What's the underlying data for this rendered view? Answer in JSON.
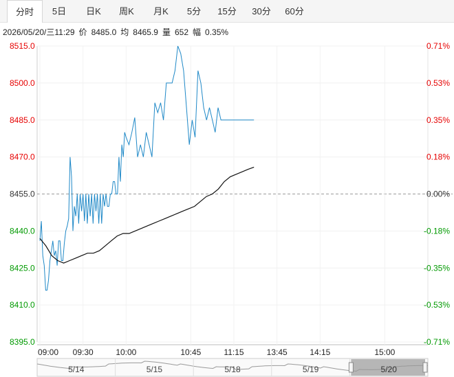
{
  "tabs": [
    "分时",
    "5日",
    "日K",
    "周K",
    "月K",
    "5分",
    "15分",
    "30分",
    "60分"
  ],
  "active_tab": 0,
  "info": {
    "datetime": "2026/05/20/三11:29",
    "price_label": "价",
    "price": "8485.0",
    "avg_label": "均",
    "avg": "8465.9",
    "volume_label": "量",
    "volume": "652",
    "change_label": "幅",
    "change": "0.35%"
  },
  "colors": {
    "up": "#e60000",
    "down": "#009900",
    "flat": "#333333",
    "price_line": "#1e88c7",
    "avg_line": "#111111"
  },
  "chart_data": {
    "type": "line",
    "ylim": [
      8395.0,
      8515.0
    ],
    "prev_close": 8455.0,
    "y_ticks": [
      "8515.0",
      "8500.0",
      "8485.0",
      "8470.0",
      "8455.0",
      "8440.0",
      "8425.0",
      "8410.0",
      "8395.0"
    ],
    "y_pct_ticks": [
      "0.71%",
      "0.53%",
      "0.35%",
      "0.18%",
      "0.00%",
      "-0.18%",
      "-0.35%",
      "-0.53%",
      "-0.71%"
    ],
    "x_ticks": [
      "09:00",
      "09:30",
      "10:00",
      "10:45",
      "11:15",
      "13:45",
      "14:15",
      "15:00"
    ],
    "series": [
      {
        "role": "price",
        "x": [
          "09:00",
          "09:01",
          "09:02",
          "09:03",
          "09:04",
          "09:05",
          "09:06",
          "09:07",
          "09:08",
          "09:09",
          "09:10",
          "09:11",
          "09:12",
          "09:13",
          "09:14",
          "09:15",
          "09:16",
          "09:17",
          "09:18",
          "09:19",
          "09:20",
          "09:21",
          "09:22",
          "09:23",
          "09:24",
          "09:25",
          "09:26",
          "09:27",
          "09:28",
          "09:29",
          "09:30",
          "09:31",
          "09:32",
          "09:33",
          "09:34",
          "09:35",
          "09:36",
          "09:37",
          "09:38",
          "09:39",
          "09:40",
          "09:41",
          "09:42",
          "09:43",
          "09:44",
          "09:45",
          "09:46",
          "09:47",
          "09:48",
          "09:49",
          "09:50",
          "09:51",
          "09:52",
          "09:53",
          "09:54",
          "09:55",
          "09:56",
          "09:57",
          "09:58",
          "09:59",
          "10:00",
          "10:02",
          "10:04",
          "10:06",
          "10:08",
          "10:10",
          "10:12",
          "10:14",
          "10:16",
          "10:18",
          "10:20",
          "10:22",
          "10:24",
          "10:26",
          "10:28",
          "10:30",
          "10:32",
          "10:34",
          "10:36",
          "10:38",
          "10:40",
          "10:42",
          "10:44",
          "10:46",
          "10:48",
          "10:50",
          "10:52",
          "10:54",
          "10:56",
          "10:58",
          "11:00",
          "11:02",
          "11:04",
          "11:06",
          "11:08",
          "11:10",
          "11:12",
          "11:14",
          "11:16",
          "11:18",
          "11:20",
          "11:22",
          "11:24",
          "11:26",
          "11:28",
          "11:29"
        ],
        "values": [
          8436,
          8444,
          8430,
          8426,
          8416,
          8416,
          8420,
          8428,
          8432,
          8436,
          8430,
          8432,
          8426,
          8436,
          8436,
          8428,
          8428,
          8435,
          8440,
          8442,
          8445,
          8470,
          8462,
          8440,
          8450,
          8446,
          8455,
          8443,
          8455,
          8448,
          8455,
          8444,
          8455,
          8443,
          8455,
          8446,
          8455,
          8443,
          8455,
          8448,
          8455,
          8443,
          8455,
          8443,
          8455,
          8450,
          8455,
          8450,
          8450,
          8455,
          8455,
          8460,
          8460,
          8455,
          8455,
          8470,
          8460,
          8475,
          8470,
          8480,
          8478,
          8475,
          8480,
          8486,
          8470,
          8475,
          8470,
          8480,
          8475,
          8470,
          8492,
          8488,
          8492,
          8485,
          8500,
          8500,
          8500,
          8505,
          8515,
          8512,
          8505,
          8490,
          8475,
          8485,
          8478,
          8505,
          8500,
          8490,
          8485,
          8490,
          8485,
          8480,
          8490,
          8485,
          8485,
          8485,
          8485,
          8485,
          8485,
          8485,
          8485,
          8485,
          8485,
          8485,
          8485,
          8485
        ],
        "note_end": "8485.0"
      },
      {
        "role": "average",
        "values": [
          8437,
          8434,
          8430,
          8428,
          8427,
          8428,
          8429,
          8430,
          8431,
          8431,
          8432,
          8434,
          8436,
          8438,
          8439,
          8439,
          8440,
          8441,
          8442,
          8443,
          8444,
          8445,
          8446,
          8447,
          8448,
          8449,
          8450,
          8452,
          8454,
          8455,
          8457,
          8460,
          8462,
          8463,
          8464,
          8465,
          8465.9
        ]
      }
    ]
  },
  "navigator": {
    "dates": [
      "5/14",
      "5/15",
      "5/18",
      "5/19",
      "5/20"
    ]
  }
}
